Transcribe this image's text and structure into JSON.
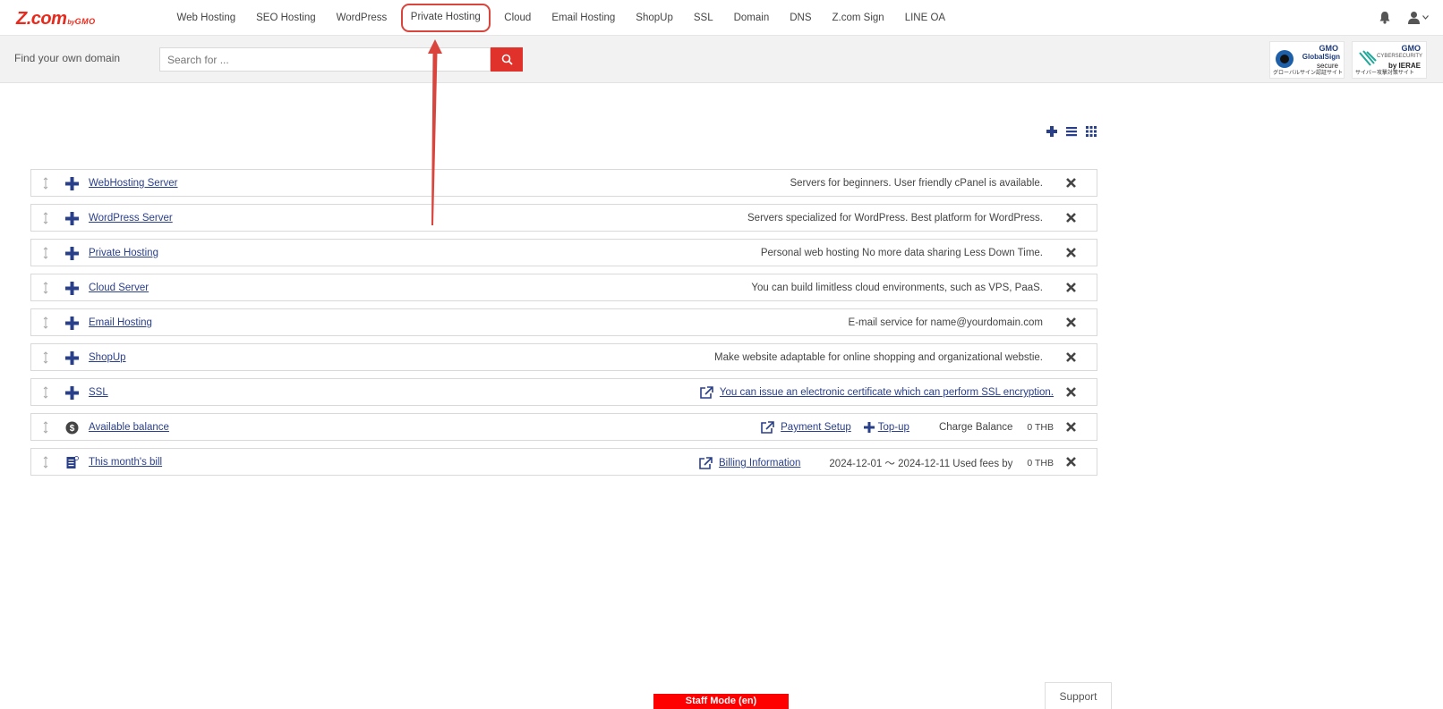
{
  "brand": {
    "logo_main": "Z.com",
    "logo_by": "by",
    "logo_gmo": "GMO"
  },
  "nav": {
    "items": [
      {
        "label": "Web Hosting"
      },
      {
        "label": "SEO Hosting"
      },
      {
        "label": "WordPress"
      },
      {
        "label": "Private Hosting",
        "highlighted": true
      },
      {
        "label": "Cloud"
      },
      {
        "label": "Email Hosting"
      },
      {
        "label": "ShopUp"
      },
      {
        "label": "SSL"
      },
      {
        "label": "Domain"
      },
      {
        "label": "DNS"
      },
      {
        "label": "Z.com Sign"
      },
      {
        "label": "LINE OA"
      }
    ],
    "icons": [
      "bell-icon",
      "user-icon",
      "chevron-down-icon"
    ]
  },
  "domain_search": {
    "label": "Find your own domain",
    "placeholder": "Search for ...",
    "button_icon": "search-icon",
    "button_color": "#e0322a"
  },
  "badges": [
    {
      "line1": "GMO",
      "line2": "GlobalSign",
      "line3": "secure",
      "caption": "グローバルサイン認証サイト"
    },
    {
      "line1": "GMO",
      "line2": "CYBERSECURITY",
      "line3": "by IERAE",
      "caption": "サイバー攻撃対策サイト"
    }
  ],
  "view_controls": [
    "plus-icon",
    "list-icon",
    "grid-icon"
  ],
  "rows": [
    {
      "title": "WebHosting Server",
      "desc": "Servers for beginners. User friendly cPanel is available."
    },
    {
      "title": "WordPress Server",
      "desc": "Servers specialized for WordPress. Best platform for WordPress."
    },
    {
      "title": "Private Hosting",
      "desc": "Personal web hosting No more data sharing Less Down Time."
    },
    {
      "title": "Cloud Server",
      "desc": "You can build limitless cloud environments, such as VPS, PaaS."
    },
    {
      "title": "Email Hosting",
      "desc": "E-mail service for name@yourdomain.com"
    },
    {
      "title": "ShopUp",
      "desc": "Make website adaptable for online shopping and organizational webstie."
    },
    {
      "title": "SSL",
      "link": "You can issue an electronic certificate which can perform SSL encryption."
    },
    {
      "title": "Available balance",
      "payment_setup": "Payment Setup",
      "topup": "Top-up",
      "charge_label": "Charge Balance",
      "amount": "0 THB"
    },
    {
      "title": "This month's bill",
      "billing": "Billing Information",
      "period": "2024-12-01 〜 2024-12-11 Used fees by",
      "amount": "0 THB"
    }
  ],
  "accent_color": "#2a3f8a",
  "annotation_color": "#d9453d",
  "footer": {
    "staff_mode": "Staff Mode (en)",
    "support": "Support"
  }
}
